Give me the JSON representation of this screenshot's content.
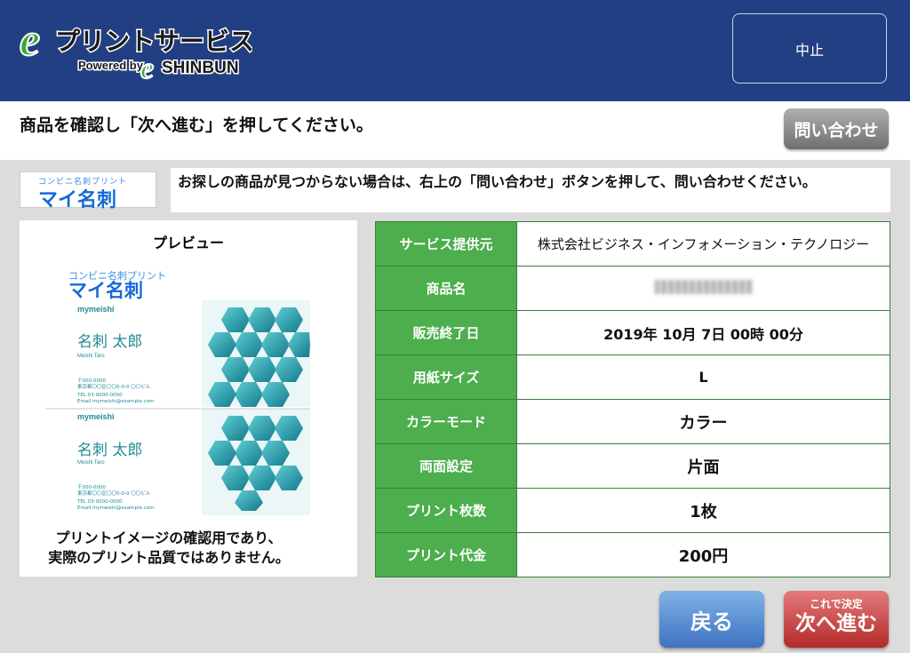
{
  "header": {
    "logo_main": "プリントサービス",
    "logo_sub_powered": "Powered by",
    "logo_sub_brand": "SHINBUN",
    "cancel_label": "中止"
  },
  "instruction": "商品を確認し「次へ進む」を押してください。",
  "inquiry_button": "問い合わせ",
  "product_logo": {
    "small": "コンビニ名刺プリント",
    "big": "マイ名刺"
  },
  "notice": "お探しの商品が見つからない場合は、右上の「問い合わせ」ボタンを押して、問い合わせください。",
  "preview": {
    "title": "プレビュー",
    "card": {
      "brand_small": "コンビニ名刺プリント",
      "brand_big": "マイ名刺",
      "company": "mymeishi",
      "name": "名刺 太郎",
      "name_roman": "Meishi Taro",
      "postal": "〒000-0000",
      "address": "東京都〇〇区〇〇0-0-0 〇〇ビル",
      "tel": "TEL 03-0000-0000",
      "email": "Email mymeishi@example.com"
    },
    "caption_line1": "プリントイメージの確認用であり、",
    "caption_line2": "実際のプリント品質ではありません。"
  },
  "details": [
    {
      "label": "サービス提供元",
      "value": "株式会社ビジネス・インフォメーション・テクノロジー"
    },
    {
      "label": "商品名",
      "value": ""
    },
    {
      "label": "販売終了日",
      "value": "2019年 10月 7日 00時 00分"
    },
    {
      "label": "用紙サイズ",
      "value": "L"
    },
    {
      "label": "カラーモード",
      "value": "カラー"
    },
    {
      "label": "両面設定",
      "value": "片面"
    },
    {
      "label": "プリント枚数",
      "value": "1枚"
    },
    {
      "label": "プリント代金",
      "value": "200円"
    }
  ],
  "buttons": {
    "back": "戻る",
    "next_small": "これで決定",
    "next_big": "次へ進む"
  },
  "colors": {
    "header_bg": "#233f84",
    "table_key_bg": "#4cae4c",
    "back_btn": "#3f73c1",
    "next_btn": "#b42a2a"
  }
}
